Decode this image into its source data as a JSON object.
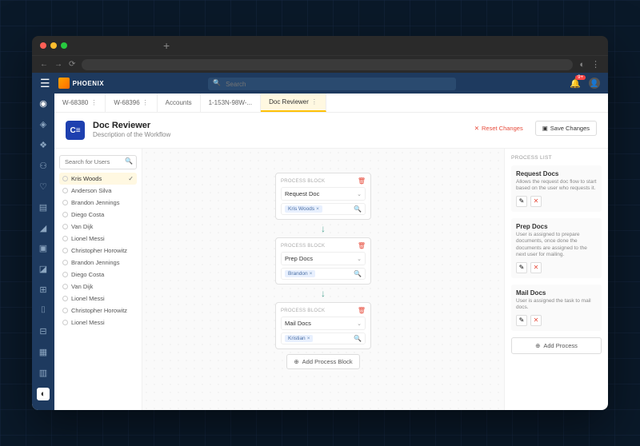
{
  "header": {
    "logo_text": "PHOENIX",
    "search_placeholder": "Search",
    "notification_count": "9+"
  },
  "tabs": [
    {
      "label": "W-68380",
      "active": false
    },
    {
      "label": "W-68396",
      "active": false
    },
    {
      "label": "Accounts",
      "active": false
    },
    {
      "label": "1-153N-98W-...",
      "active": false
    },
    {
      "label": "Doc Reviewer",
      "active": true
    }
  ],
  "page": {
    "title": "Doc Reviewer",
    "subtitle": "Description of the Workflow",
    "icon": "C≡",
    "reset_label": "Reset Changes",
    "save_label": "Save Changes"
  },
  "user_search_placeholder": "Search for Users",
  "users": [
    {
      "name": "Kris Woods",
      "selected": true
    },
    {
      "name": "Anderson Silva"
    },
    {
      "name": "Brandon Jennings"
    },
    {
      "name": "Diego Costa"
    },
    {
      "name": "Van Dijk"
    },
    {
      "name": "Lionel Messi"
    },
    {
      "name": "Christopher Horowitz"
    },
    {
      "name": "Brandon Jennings"
    },
    {
      "name": "Diego Costa"
    },
    {
      "name": "Van Dijk"
    },
    {
      "name": "Lionel Messi"
    },
    {
      "name": "Christopher Horowitz"
    },
    {
      "name": "Lionel Messi"
    }
  ],
  "process_blocks": {
    "label": "PROCESS BLOCK",
    "add_label": "Add Process Block",
    "items": [
      {
        "process": "Request Doc",
        "chip": "Kris Woods"
      },
      {
        "process": "Prep Docs",
        "chip": "Brandon"
      },
      {
        "process": "Mail Docs",
        "chip": "Kristian"
      }
    ]
  },
  "process_list": {
    "title": "PROCESS LIST",
    "add_label": "Add Process",
    "items": [
      {
        "title": "Request Docs",
        "desc": "Allows the request doc flow to start based on the user who requests it."
      },
      {
        "title": "Prep Docs",
        "desc": "User is assigned to prepare documents, once done the documents are assigned to the next user for mailing."
      },
      {
        "title": "Mail Docs",
        "desc": "User is assigned the task to mail docs."
      }
    ]
  }
}
